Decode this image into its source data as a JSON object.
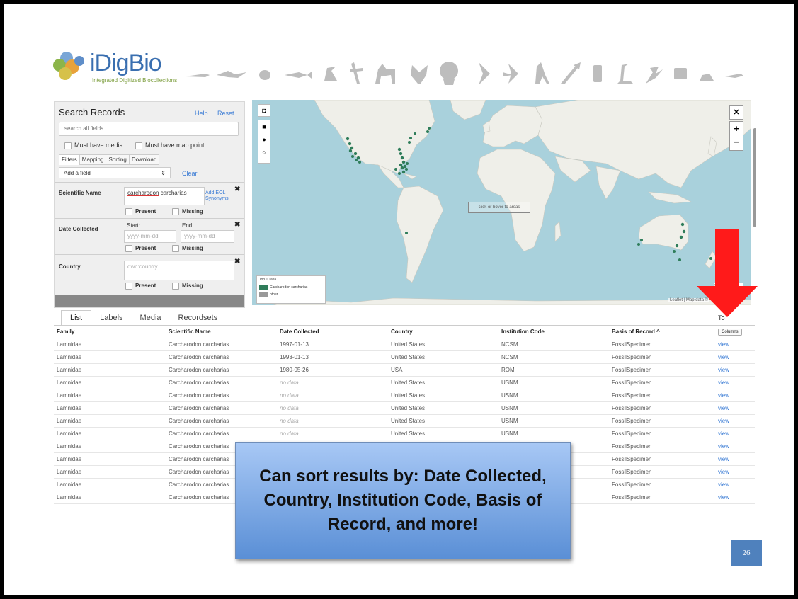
{
  "header": {
    "logo_text": "iDigBio",
    "logo_tagline": "Integrated Digitized Biocollections"
  },
  "search_panel": {
    "title": "Search Records",
    "help": "Help",
    "reset": "Reset",
    "search_placeholder": "search all fields",
    "must_have_media": "Must have media",
    "must_have_map_point": "Must have map point",
    "tabs": [
      "Filters",
      "Mapping",
      "Sorting",
      "Download"
    ],
    "add_field": "Add a field",
    "clear": "Clear",
    "scientific_name_label": "Scientific Name",
    "scientific_name_value_1": "carcharodon",
    "scientific_name_value_2": " carcharias",
    "add_eol": "Add EOL",
    "synonyms": "Synonyms",
    "present": "Present",
    "missing": "Missing",
    "date_collected_label": "Date Collected",
    "start": "Start:",
    "end": "End:",
    "date_placeholder": "yyyy-mm-dd",
    "country_label": "Country",
    "country_placeholder": "dwc:country"
  },
  "map": {
    "click_hover": "click or hover to areas",
    "legend_title": "Top 1 Taxa",
    "legend_taxon": "Carcharodon carcharias",
    "legend_other": "other",
    "attribution": "Leaflet | Map data ©",
    "scale_1": "300",
    "scale_2": "200"
  },
  "result_tabs": [
    "List",
    "Labels",
    "Media",
    "Recordsets"
  ],
  "top_right_label": "To",
  "table": {
    "headers": [
      "Family",
      "Scientific Name",
      "Date Collected",
      "Country",
      "Institution Code",
      "Basis of Record ^"
    ],
    "columns_button": "Columns",
    "rows": [
      [
        "Lamnidae",
        "Carcharodon carcharias",
        "1997-01-13",
        "United States",
        "NCSM",
        "FossilSpecimen",
        "view"
      ],
      [
        "Lamnidae",
        "Carcharodon carcharias",
        "1993-01-13",
        "United States",
        "NCSM",
        "FossilSpecimen",
        "view"
      ],
      [
        "Lamnidae",
        "Carcharodon carcharias",
        "1980-05-26",
        "USA",
        "ROM",
        "FossilSpecimen",
        "view"
      ],
      [
        "Lamnidae",
        "Carcharodon carcharias",
        "no data",
        "United States",
        "USNM",
        "FossilSpecimen",
        "view"
      ],
      [
        "Lamnidae",
        "Carcharodon carcharias",
        "no data",
        "United States",
        "USNM",
        "FossilSpecimen",
        "view"
      ],
      [
        "Lamnidae",
        "Carcharodon carcharias",
        "no data",
        "United States",
        "USNM",
        "FossilSpecimen",
        "view"
      ],
      [
        "Lamnidae",
        "Carcharodon carcharias",
        "no data",
        "United States",
        "USNM",
        "FossilSpecimen",
        "view"
      ],
      [
        "Lamnidae",
        "Carcharodon carcharias",
        "no data",
        "United States",
        "USNM",
        "FossilSpecimen",
        "view"
      ],
      [
        "Lamnidae",
        "Carcharodon carcharias",
        "",
        "",
        "",
        "FossilSpecimen",
        "view"
      ],
      [
        "Lamnidae",
        "Carcharodon carcharias",
        "",
        "",
        "",
        "FossilSpecimen",
        "view"
      ],
      [
        "Lamnidae",
        "Carcharodon carcharias",
        "",
        "",
        "",
        "FossilSpecimen",
        "view"
      ],
      [
        "Lamnidae",
        "Carcharodon carcharias",
        "",
        "",
        "",
        "FossilSpecimen",
        "view"
      ],
      [
        "Lamnidae",
        "Carcharodon carcharias",
        "",
        "",
        "",
        "FossilSpecimen",
        "view"
      ]
    ]
  },
  "callout": {
    "text": "Can sort results by: Date Collected, Country, Institution Code, Basis of Record, and more!"
  },
  "page_number": "26",
  "colors": {
    "accent_blue": "#3a7bd5",
    "arrow_red": "#ff1a1a",
    "map_ocean": "#a9d1dc",
    "map_land": "#efefe9",
    "marker_green": "#2f7d5a",
    "callout_top": "#a8c8f5",
    "callout_bottom": "#5a8fd6"
  }
}
